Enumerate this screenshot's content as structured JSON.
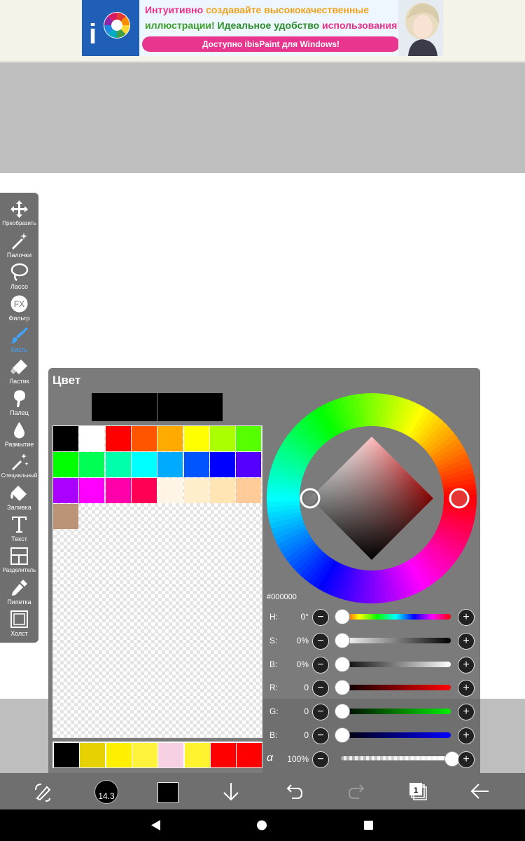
{
  "ad": {
    "line1_a": "Интуитивно",
    "line1_b": "создавайте высококачественные",
    "line2_a": "иллюстрации!",
    "line2_b": "Идеальное удобство",
    "line2_c": "использования!",
    "cta": "Доступно ibisPaint для Windows!",
    "logo_icon": "ibispaint-logo-icon"
  },
  "tools": [
    {
      "label": "Преобразить",
      "icon": "move-transform-icon"
    },
    {
      "label": "Палочки",
      "icon": "magic-wand-icon"
    },
    {
      "label": "Лассо",
      "icon": "lasso-icon"
    },
    {
      "label": "Фильтр",
      "icon": "fx-filter-icon"
    },
    {
      "label": "Кисть",
      "icon": "brush-icon",
      "active": true
    },
    {
      "label": "Ластик",
      "icon": "eraser-icon"
    },
    {
      "label": "Палец",
      "icon": "finger-smudge-icon"
    },
    {
      "label": "Размытие",
      "icon": "blur-drop-icon"
    },
    {
      "label": "Специальный",
      "icon": "special-pen-icon"
    },
    {
      "label": "Заливка",
      "icon": "fill-bucket-icon"
    },
    {
      "label": "Текст",
      "icon": "text-icon"
    },
    {
      "label": "Разделитель",
      "icon": "frame-divider-icon"
    },
    {
      "label": "Пипетка",
      "icon": "eyedropper-icon"
    },
    {
      "label": "Холст",
      "icon": "canvas-icon"
    }
  ],
  "color_panel": {
    "title": "Цвет",
    "hex": "#000000",
    "previous_color": "#000000",
    "current_color": "#000000",
    "palette": [
      "#000000",
      "#ffffff",
      "#ff0000",
      "#ff5500",
      "#ffaa00",
      "#ffff00",
      "#aaff00",
      "#55ff00",
      "#00ff00",
      "#00ff55",
      "#00ffaa",
      "#00ffff",
      "#00aaff",
      "#0055ff",
      "#0000ff",
      "#5500ff",
      "#aa00ff",
      "#ff00ff",
      "#ff00aa",
      "#ff0055",
      "#fff5e6",
      "#ffeecc",
      "#ffe5b3",
      "#ffcc99",
      "#bb9377"
    ],
    "recent_colors": [
      "#000000",
      "#e6d200",
      "#fff000",
      "#fff23a",
      "#f8d0e4",
      "#fff22e",
      "#ff0000",
      "#ff0000"
    ],
    "sliders": [
      {
        "label": "H:",
        "value": "0°",
        "level": 0,
        "track": "hue"
      },
      {
        "label": "S:",
        "value": "0%",
        "level": 0,
        "track": "sat"
      },
      {
        "label": "B:",
        "value": "0%",
        "level": 0,
        "track": "bri"
      },
      {
        "label": "R:",
        "value": "0",
        "level": 0,
        "track": "red"
      },
      {
        "label": "G:",
        "value": "0",
        "level": 0,
        "track": "green"
      },
      {
        "label": "B:",
        "value": "0",
        "level": 0,
        "track": "blue"
      },
      {
        "label": "α",
        "value": "100%",
        "level": 1,
        "track": "alpha"
      }
    ],
    "minus_symbol": "−",
    "plus_symbol": "+"
  },
  "bottom_bar": {
    "brush_size": "14.3",
    "layer_count": "1",
    "current_color": "#000000"
  },
  "colors": {
    "panel_bg": "#7b7b7b",
    "toolbar_bg": "#6f6f6f",
    "active_tool": "#3fa4ff"
  }
}
